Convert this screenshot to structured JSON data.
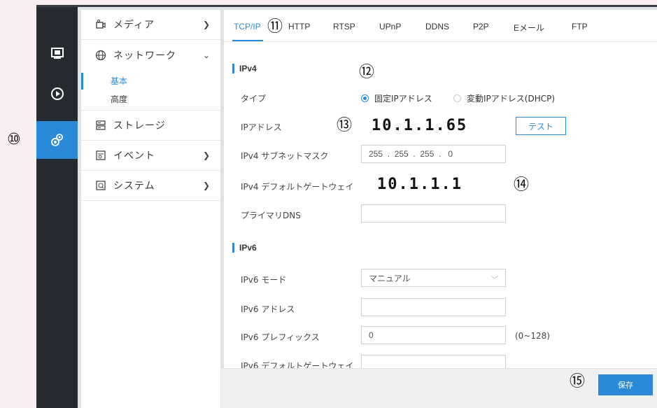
{
  "callouts": {
    "c10": "⑩",
    "c11": "⑪",
    "c12": "⑫",
    "c13": "⑬",
    "c14": "⑭",
    "c15": "⑮"
  },
  "leftbar": {
    "icons": [
      "monitor-icon",
      "play-icon",
      "settings-icon"
    ],
    "active_color": "#2b8ad8"
  },
  "sidebar": {
    "media": "メディア",
    "network": "ネットワーク",
    "network_sub": [
      "基本",
      "高度"
    ],
    "storage": "ストレージ",
    "event": "イベント",
    "system": "システム"
  },
  "tabs": [
    "TCP/IP",
    "HTTP",
    "RTSP",
    "UPnP",
    "DDNS",
    "P2P",
    "Eメール",
    "FTP"
  ],
  "ipv4": {
    "title": "IPv4",
    "type_label": "タイプ",
    "radio_static": "固定IPアドレス",
    "radio_dhcp": "変動IPアドレス(DHCP)",
    "ip_label": "IPアドレス",
    "ip_value": "10.1.1.65",
    "test_button": "テスト",
    "mask_label": "IPv4 サブネットマスク",
    "mask_value": "255  .  255  .  255  .   0",
    "gateway_label": "IPv4 デフォルトゲートウェイ",
    "gateway_value": "10.1.1.1",
    "dns_label": "プライマリDNS",
    "dns_value": ""
  },
  "ipv6": {
    "title": "IPv6",
    "mode_label": "IPv6 モード",
    "mode_value": "マニュアル",
    "addr_label": "IPv6 アドレス",
    "addr_value": "",
    "prefix_label": "IPv6 プレフィックス",
    "prefix_value": "0",
    "prefix_range": "(0~128)",
    "gateway_label": "IPv6 デフォルトゲートウェイ",
    "gateway_value": ""
  },
  "footer": {
    "save_button": "保存"
  }
}
